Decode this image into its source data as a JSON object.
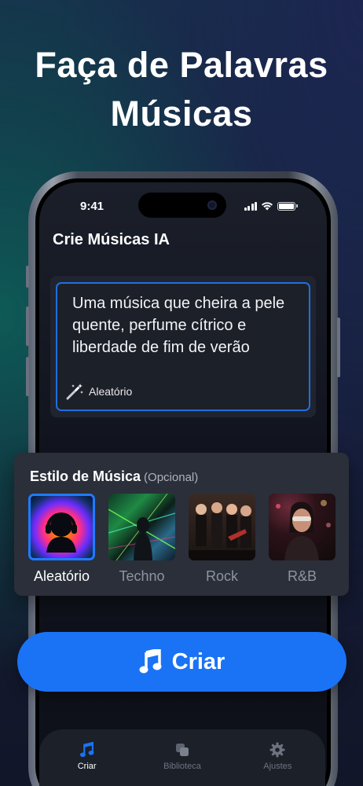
{
  "headline": [
    "Faça de Palavras",
    "Músicas"
  ],
  "status": {
    "time": "9:41"
  },
  "app_title": "Crie Músicas IA",
  "prompt": {
    "text": "Uma música que cheira a pele quente, perfume cítrico e liberdade de fim de verão",
    "random_label": "Aleatório"
  },
  "style_section": {
    "title": "Estilo de Música",
    "optional": "(Opcional)",
    "items": [
      {
        "label": "Aleatório",
        "selected": true
      },
      {
        "label": "Techno",
        "selected": false
      },
      {
        "label": "Rock",
        "selected": false
      },
      {
        "label": "R&B",
        "selected": false
      }
    ]
  },
  "create_button": {
    "label": "Criar",
    "icon": "music-note-icon"
  },
  "tabs": [
    {
      "label": "Criar",
      "icon": "music-note-icon",
      "active": true
    },
    {
      "label": "Biblioteca",
      "icon": "library-icon",
      "active": false
    },
    {
      "label": "Ajustes",
      "icon": "gear-icon",
      "active": false
    }
  ],
  "colors": {
    "accent": "#1a73f5",
    "card": "#2a2f3a"
  }
}
